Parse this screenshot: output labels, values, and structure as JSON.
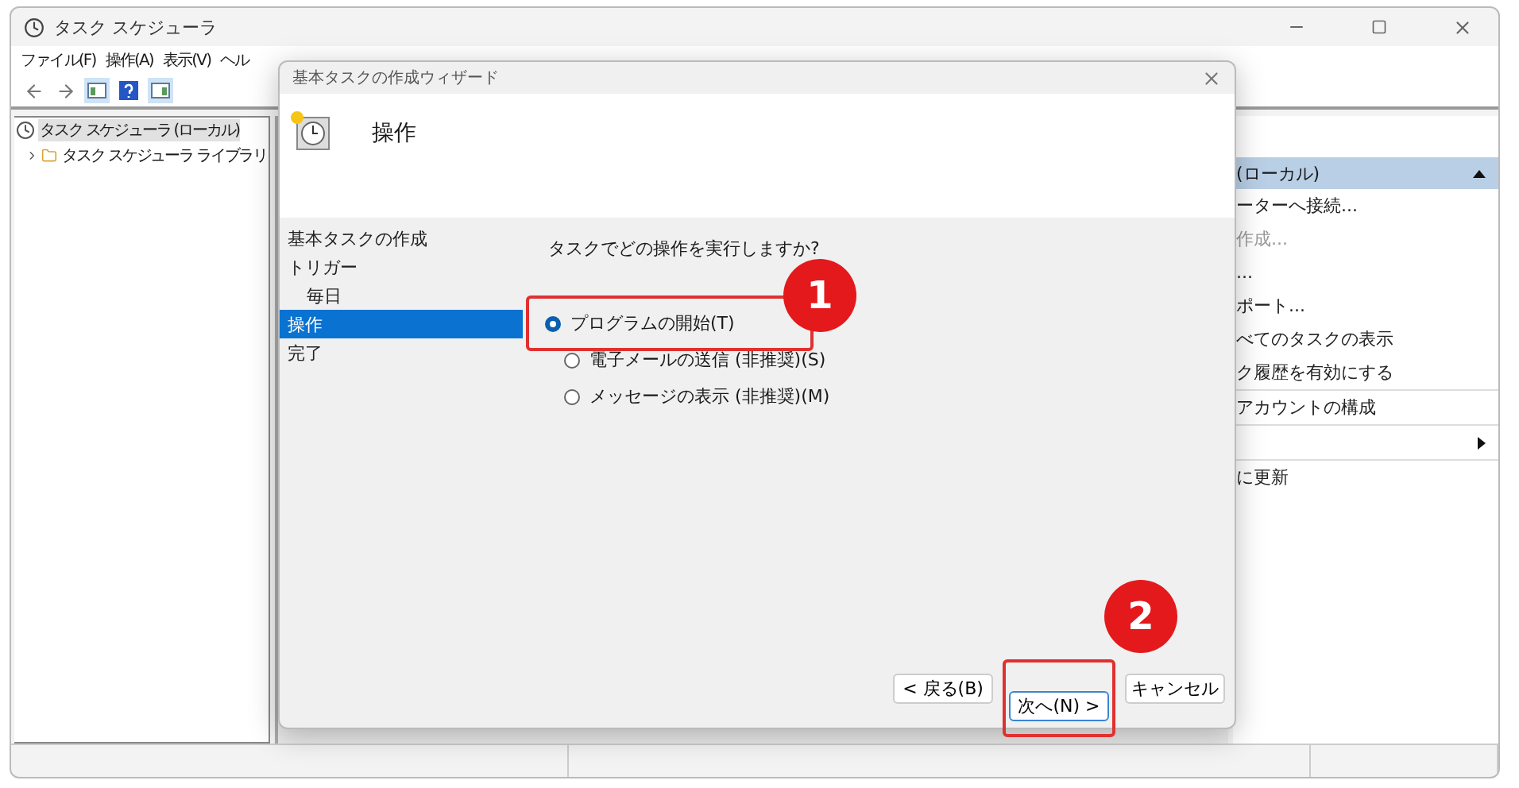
{
  "window": {
    "title": "タスク スケジューラ",
    "menu": [
      "ファイル(F)",
      "操作(A)",
      "表示(V)",
      "ヘル"
    ]
  },
  "tree": [
    {
      "label": "タスク スケジューラ (ローカル)",
      "selected": true,
      "children": [
        {
          "label": "タスク スケジューラ ライブラリ",
          "selected": false,
          "expanded": false
        }
      ]
    }
  ],
  "actions": {
    "header": "(ローカル)",
    "items": [
      {
        "label": "ーターへ接続...",
        "kind": "item",
        "disabled": false
      },
      {
        "label": "作成...",
        "kind": "item",
        "disabled": true
      },
      {
        "label": "...",
        "kind": "item",
        "disabled": false
      },
      {
        "label": "ポート...",
        "kind": "item",
        "disabled": false
      },
      {
        "label": "べてのタスクの表示",
        "kind": "item",
        "disabled": false
      },
      {
        "label": "ク履歴を有効にする",
        "kind": "item",
        "disabled": false
      },
      {
        "label": "アカウントの構成",
        "kind": "item",
        "disabled": false
      },
      {
        "kind": "submenu",
        "disabled": false
      },
      {
        "label": "に更新",
        "kind": "item",
        "disabled": false
      }
    ]
  },
  "dialog": {
    "title": "基本タスクの作成ウィザード",
    "heading": "操作",
    "steps": [
      {
        "label": "基本タスクの作成",
        "selected": false
      },
      {
        "label": "トリガー",
        "selected": false,
        "children": [
          {
            "label": "毎日",
            "selected": false
          }
        ]
      },
      {
        "label": "操作",
        "selected": true
      },
      {
        "label": "完了",
        "selected": false
      }
    ],
    "question": "タスクでどの操作を実行しますか?",
    "options": [
      {
        "label": "プログラムの開始(T)",
        "selected": true,
        "highlighted": true,
        "callout": "1"
      },
      {
        "label": "電子メールの送信 (非推奨)(S)",
        "selected": false,
        "highlighted": false
      },
      {
        "label": "メッセージの表示 (非推奨)(M)",
        "selected": false,
        "highlighted": false
      }
    ],
    "buttons": [
      {
        "label": "< 戻る(B)",
        "focused": false,
        "highlighted": false
      },
      {
        "label": "次へ(N) >",
        "focused": true,
        "highlighted": true,
        "callout": "2"
      },
      {
        "label": "キャンセル",
        "focused": false,
        "highlighted": false
      }
    ]
  }
}
